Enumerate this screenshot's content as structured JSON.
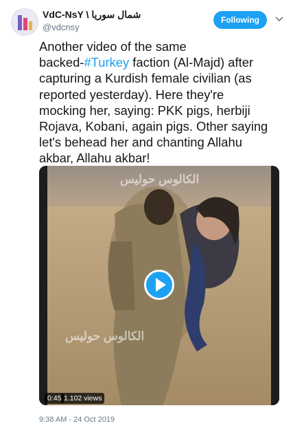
{
  "user": {
    "display_name": "VdC-NsY \\ شمال سوريا",
    "handle": "@vdcnsy",
    "avatar_icon": "avatar-chart-logo"
  },
  "follow_button": {
    "label": "Following",
    "color": "#1da1f2"
  },
  "menu": {
    "icon": "chevron-down-icon"
  },
  "tweet": {
    "lines": [
      {
        "text": "Another video of the same"
      },
      {
        "before": "backed-",
        "hashtag": "#Turkey",
        "after": " faction (Al-Majd) after"
      },
      {
        "text": "capturing a Kurdish female civilian (as"
      },
      {
        "text": "reported yesterday). Here they're"
      },
      {
        "text": "mocking her, saying: PKK pigs, herbiji"
      },
      {
        "text": "Rojava, Kobani, again pigs. Other saying"
      },
      {
        "text": "let's behead her and chanting Allahu"
      },
      {
        "text": "akbar, Allahu akbar!"
      }
    ],
    "hashtag_color": "#1da1f2"
  },
  "video": {
    "duration": "0:45",
    "views": "1.102 views",
    "play_icon": "play-icon",
    "watermark_top": "الكالوس حوليس",
    "watermark_bottom": "الكالوس حوليس"
  },
  "timestamp": "9:38 AM - 24 Oct 2019"
}
